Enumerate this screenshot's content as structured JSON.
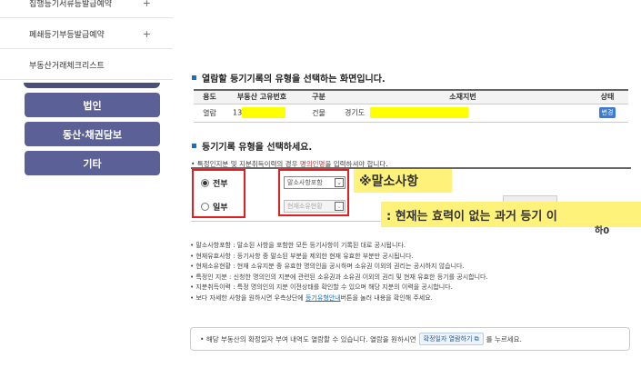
{
  "sidebar": {
    "menu": [
      {
        "label": "집행등기서류등발급예약",
        "plus": "+"
      },
      {
        "label": "폐쇄등기부등발급예약",
        "plus": "+"
      },
      {
        "label": "부동산거래체크리스트",
        "plus": ""
      }
    ],
    "buttons": [
      "법인",
      "동산·채권담보",
      "기타"
    ]
  },
  "section1": {
    "title": "열람할 등기기록의 유형을 선택하는 화면입니다.",
    "table": {
      "headers": [
        "용도",
        "부동산 고유번호",
        "구분",
        "소재지번",
        "상태"
      ],
      "row": {
        "usage": "열람",
        "unique_no_prefix": "13",
        "type": "건물",
        "address_prefix": "경기도",
        "status": "변경"
      }
    }
  },
  "section2": {
    "title": "등기기록 유형을 선택하세요.",
    "note_before": "특정인지분 및 지분취득이력의 경우 ",
    "note_red": "명의인명",
    "note_after": "을 입력하셔야 합니다.",
    "radio_all": "전부",
    "radio_partial": "일부",
    "dropdown_all": "말소사항포함",
    "dropdown_partial": "현재소유현황"
  },
  "annotation": {
    "line1": "※말소사항",
    "line2": ": 현재는 효력이 없는 과거 등기 이"
  },
  "edge_text": "하0",
  "descriptions": [
    "말소사항포함 : 말소된 사항을 포함한 모든 등기사항이 기록된 대로 공시됩니다.",
    "현재유효사항 : 등기사항 중 말소된 부분을 제외한 현재 유효한 부분만 공시됩니다.",
    "현재소유현황 : 현재 소유지분 중 유효한 명의인을 공시하며 소유권 이외의 권리는 공시하지 않습니다.",
    "특정인 지분 : 신청한 명의인의 지분에 관련된 소유권과 소유권 이외의 권리 및 현재 유효한 등기를 공시합니다.",
    "지분취득이력 : 특정 명의인의 지분 이전상태를 확인할 수 있으며 해당 지분의 이력을 공시합니다."
  ],
  "desc_last": {
    "before": "보다 자세한 사항을 원하시면 우측상단에 ",
    "link": "등기유형안내",
    "after": "버튼을 눌러 내용을 확인해 주세요."
  },
  "notice": {
    "before": "해당 부동산의 확정일자 부여 내역도 열람할 수 있습니다. 열람을 원하시면 ",
    "button": "확정일자 열람하기",
    "after": "를 누르세요."
  }
}
